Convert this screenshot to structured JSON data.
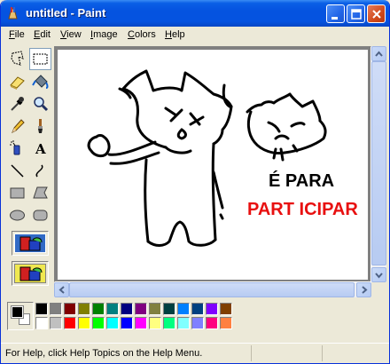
{
  "window": {
    "title": "untitled - Paint"
  },
  "menu": [
    {
      "label": "File",
      "accel": "F",
      "rest": "ile"
    },
    {
      "label": "Edit",
      "accel": "E",
      "rest": "dit"
    },
    {
      "label": "View",
      "accel": "V",
      "rest": "iew"
    },
    {
      "label": "Image",
      "accel": "I",
      "rest": "mage"
    },
    {
      "label": "Colors",
      "accel": "C",
      "rest": "olors"
    },
    {
      "label": "Help",
      "accel": "H",
      "rest": "elp"
    }
  ],
  "tools": [
    "free-form-select-icon",
    "select-icon",
    "eraser-icon",
    "fill-icon",
    "pick-color-icon",
    "magnifier-icon",
    "pencil-icon",
    "brush-icon",
    "airbrush-icon",
    "text-icon",
    "line-icon",
    "curve-icon",
    "rectangle-icon",
    "polygon-icon",
    "ellipse-icon",
    "rounded-rectangle-icon"
  ],
  "selected_tool": "select-icon",
  "canvas_text": {
    "line1": "É PARA",
    "line2": "PART ICIPAR",
    "line2_color": "#e81010"
  },
  "colors": {
    "foreground": "#000000",
    "background": "#ffffff",
    "palette": [
      "#000000",
      "#808080",
      "#800000",
      "#808000",
      "#008000",
      "#008080",
      "#000080",
      "#800080",
      "#808040",
      "#004040",
      "#0080ff",
      "#004080",
      "#8000ff",
      "#804000",
      "#ffffff",
      "#c0c0c0",
      "#ff0000",
      "#ffff00",
      "#00ff00",
      "#00ffff",
      "#0000ff",
      "#ff00ff",
      "#ffff80",
      "#00ff80",
      "#80ffff",
      "#8080ff",
      "#ff0080",
      "#ff8040"
    ]
  },
  "status": {
    "help_text": "For Help, click Help Topics on the Help Menu."
  }
}
